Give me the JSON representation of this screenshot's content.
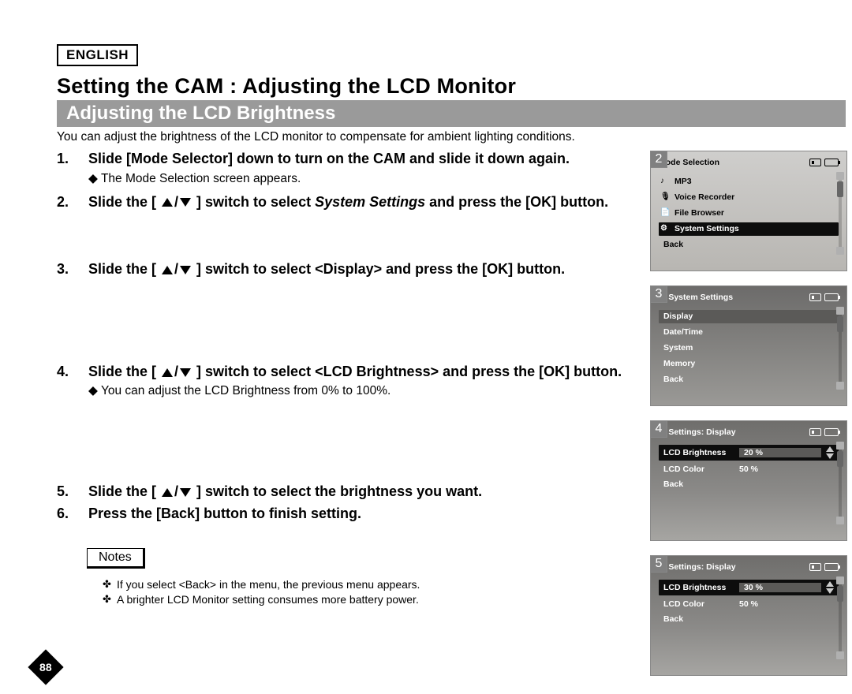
{
  "lang": "ENGLISH",
  "title": "Setting the CAM : Adjusting the LCD Monitor",
  "section": "Adjusting the LCD Brightness",
  "intro": "You can adjust the brightness of the LCD monitor to compensate for ambient lighting conditions.",
  "steps": {
    "s1": {
      "num": "1.",
      "text": "Slide [Mode Selector] down to turn on the CAM and slide it down again.",
      "sub": "◆ The Mode Selection screen appears."
    },
    "s2": {
      "num": "2.",
      "pre": "Slide the [ ",
      "tail": " ] switch to select",
      "em": "System Settings",
      "post": " and press the [OK] button."
    },
    "s3": {
      "num": "3.",
      "pre": "Slide the [ ",
      "tail": " ] switch to select <Display> and press the [OK] button."
    },
    "s4": {
      "num": "4.",
      "pre": "Slide the [ ",
      "tail": " ] switch to select <LCD Brightness> and press the [OK] button.",
      "sub": "◆ You can adjust the LCD Brightness from 0% to 100%."
    },
    "s5": {
      "num": "5.",
      "pre": "Slide the [ ",
      "tail": " ] switch to select the brightness you want."
    },
    "s6": {
      "num": "6.",
      "text": "Press the [Back] button to finish setting."
    }
  },
  "notes_label": "Notes",
  "notes": {
    "n1": "If you select <Back> in the menu, the previous menu appears.",
    "n2": "A brighter LCD Monitor setting consumes more battery power."
  },
  "page_number": "88",
  "shots": {
    "s2": {
      "badge": "2",
      "title": "Mode Selection",
      "items": [
        {
          "icon": "♪",
          "label": "MP3"
        },
        {
          "icon": "🎙",
          "label": "Voice Recorder"
        },
        {
          "icon": "📄",
          "label": "File Browser"
        },
        {
          "icon": "⚙",
          "label": "System Settings",
          "sel": true
        }
      ],
      "back": "Back"
    },
    "s3": {
      "badge": "3",
      "title": "System Settings",
      "items": [
        {
          "label": "Display",
          "sel": true
        },
        {
          "label": "Date/Time"
        },
        {
          "label": "System"
        },
        {
          "label": "Memory"
        },
        {
          "label": "Back"
        }
      ]
    },
    "s4": {
      "badge": "4",
      "title": "Settings: Display",
      "rows": [
        {
          "label": "LCD Brightness",
          "value": "20 %",
          "sel": true
        },
        {
          "label": "LCD Color",
          "value": "50 %"
        }
      ],
      "back": "Back"
    },
    "s5": {
      "badge": "5",
      "title": "Settings: Display",
      "rows": [
        {
          "label": "LCD Brightness",
          "value": "30 %",
          "sel": true
        },
        {
          "label": "LCD Color",
          "value": "50 %"
        }
      ],
      "back": "Back"
    }
  }
}
